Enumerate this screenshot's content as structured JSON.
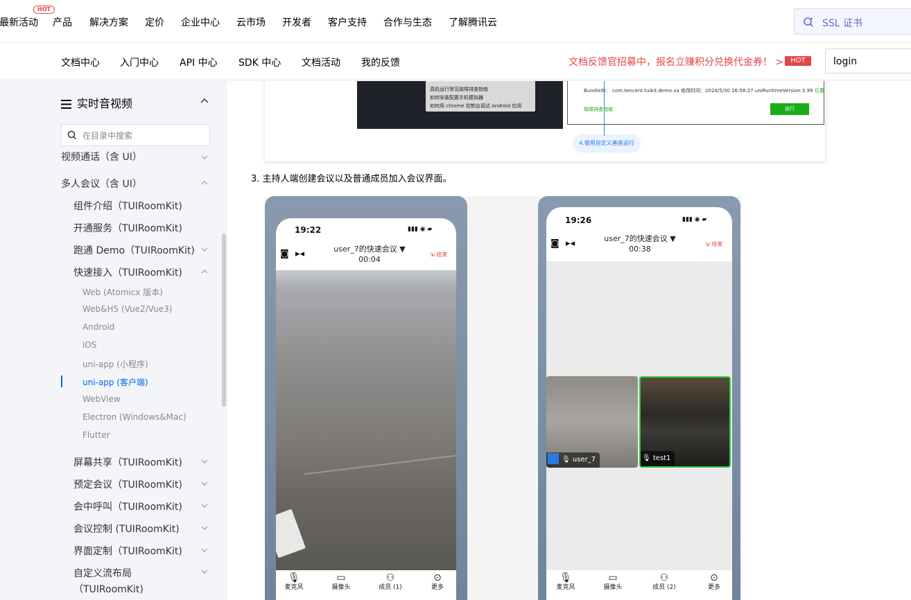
{
  "top_nav": {
    "hot_badge": "HOT",
    "items": [
      "最新活动",
      "产品",
      "解决方案",
      "定价",
      "企业中心",
      "云市场",
      "开发者",
      "客户支持",
      "合作与生态",
      "了解腾讯云"
    ],
    "search_value": "SSL 证书"
  },
  "doc_nav": {
    "items": [
      "文档中心",
      "入门中心",
      "API 中心",
      "SDK 中心",
      "文档活动",
      "我的反馈"
    ],
    "promo_text": "文档反馈官招募中，报名立赚积分兑换代金券！ >",
    "promo_badge": "HOT",
    "login_value": "login"
  },
  "sidebar": {
    "title": "实时音视频",
    "search_placeholder": "在目录中搜索",
    "items": [
      "视频通话（含 UI）",
      "多人会议（含 UI）",
      "组件介绍（TUIRoomKit)",
      "开通服务（TUIRoomKit)",
      "跑通 Demo（TUIRoomKit)",
      "快速接入（TUIRoomKit)",
      "屏幕共享（TUIRoomKit)",
      "预定会议（TUIRoomKit)",
      "会中呼叫（TUIRoomKit)",
      "会议控制 (TUIRoomKit)",
      "界面定制（TUIRoomKit)",
      "自定义流布局",
      "（TUIRoomKit)"
    ],
    "sub_items": [
      "Web (Atomicx 版本)",
      "Web&H5 (Vue2/Vue3)",
      "Android",
      "iOS",
      "uni-app (小程序)",
      "uni-app (客户端)",
      "WebView",
      "Electron (Windows&Mac)",
      "Flutter"
    ],
    "active_sub_item": "uni-app (客户端)"
  },
  "content": {
    "shot1": {
      "popup_lines": [
        "真机运行常见故障排查指南",
        "如何安装配置手机模拟器",
        "如何用 chrome 控制台调试 Android 应用"
      ],
      "ide_line": "BundleID： com.tencent.tuikit.demo.xa   修改时间：2024/5/30 16:58:27   uniRuntimeVersion:3.99",
      "ide_line_link": "位置",
      "ide_link": "故障排查指南",
      "ide_button": "运行",
      "tip": "4.使用自定义基座运行"
    },
    "step_text": "3.  主持人端创建会议以及普通成员加入会议界面。",
    "phone_left": {
      "time": "19:22",
      "meeting_title": "user_7的快速会议 ▼",
      "duration": "00:04",
      "end": "结束",
      "toolbar": [
        "麦克风",
        "摄像头",
        "成员 (1)",
        "更多"
      ]
    },
    "phone_right": {
      "time": "19:26",
      "meeting_title": "user_7的快速会议 ▼",
      "duration": "00:38",
      "end": "结束",
      "tiles": [
        "user_7",
        "test1"
      ],
      "toolbar": [
        "麦克风",
        "摄像头",
        "成员 (2)",
        "更多"
      ]
    }
  }
}
